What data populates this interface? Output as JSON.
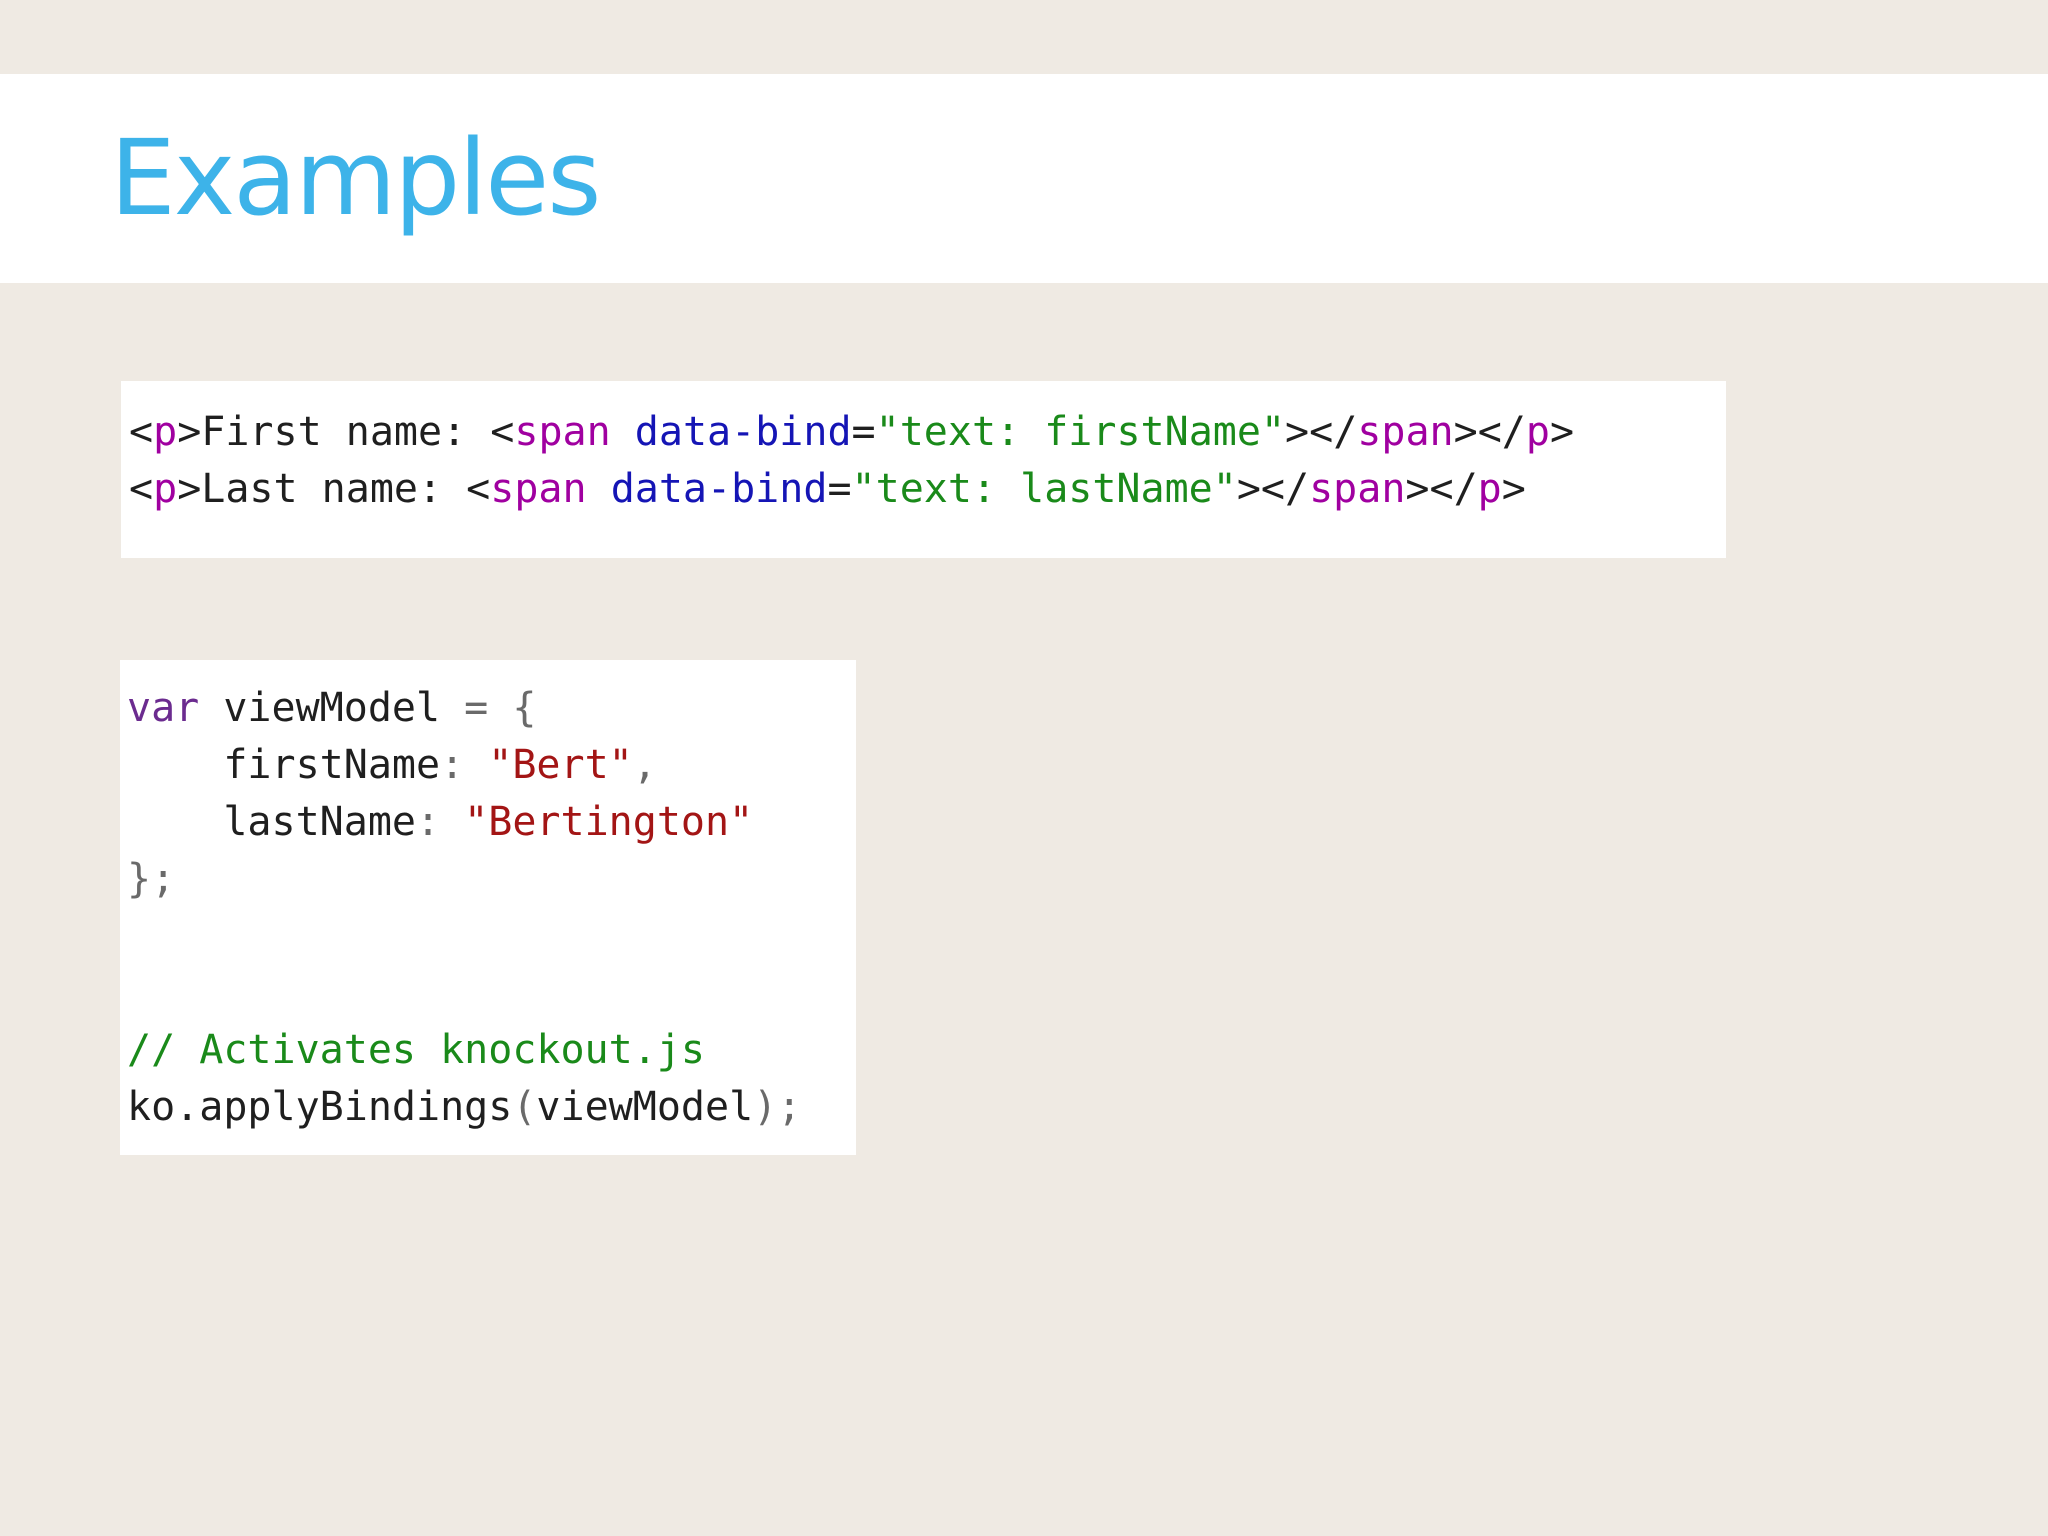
{
  "slide": {
    "title": "Examples"
  },
  "html_snippet": {
    "lines": [
      [
        {
          "t": "<",
          "c": "tk-punct"
        },
        {
          "t": "p",
          "c": "tk-tag"
        },
        {
          "t": ">First name: ",
          "c": "tk-punct"
        },
        {
          "t": "<",
          "c": "tk-punct"
        },
        {
          "t": "span",
          "c": "tk-tag"
        },
        {
          "t": " ",
          "c": "tk-punct"
        },
        {
          "t": "data-bind",
          "c": "tk-attr"
        },
        {
          "t": "=",
          "c": "tk-punct"
        },
        {
          "t": "\"text: firstName\"",
          "c": "tk-str"
        },
        {
          "t": "></",
          "c": "tk-punct"
        },
        {
          "t": "span",
          "c": "tk-tag"
        },
        {
          "t": "></",
          "c": "tk-punct"
        },
        {
          "t": "p",
          "c": "tk-tag"
        },
        {
          "t": ">",
          "c": "tk-punct"
        }
      ],
      [
        {
          "t": "<",
          "c": "tk-punct"
        },
        {
          "t": "p",
          "c": "tk-tag"
        },
        {
          "t": ">Last name: ",
          "c": "tk-punct"
        },
        {
          "t": "<",
          "c": "tk-punct"
        },
        {
          "t": "span",
          "c": "tk-tag"
        },
        {
          "t": " ",
          "c": "tk-punct"
        },
        {
          "t": "data-bind",
          "c": "tk-attr"
        },
        {
          "t": "=",
          "c": "tk-punct"
        },
        {
          "t": "\"text: lastName\"",
          "c": "tk-str"
        },
        {
          "t": "></",
          "c": "tk-punct"
        },
        {
          "t": "span",
          "c": "tk-tag"
        },
        {
          "t": "></",
          "c": "tk-punct"
        },
        {
          "t": "p",
          "c": "tk-tag"
        },
        {
          "t": ">",
          "c": "tk-punct"
        }
      ]
    ]
  },
  "js_snippet": {
    "lines": [
      [
        {
          "t": "var",
          "c": "tk-kw"
        },
        {
          "t": " viewModel ",
          "c": "tk-plain"
        },
        {
          "t": "= {",
          "c": "tk-op"
        }
      ],
      [
        {
          "t": "    firstName",
          "c": "tk-plain"
        },
        {
          "t": ": ",
          "c": "tk-op"
        },
        {
          "t": "\"Bert\"",
          "c": "tk-jsstr"
        },
        {
          "t": ",",
          "c": "tk-op"
        }
      ],
      [
        {
          "t": "    lastName",
          "c": "tk-plain"
        },
        {
          "t": ": ",
          "c": "tk-op"
        },
        {
          "t": "\"Bertington\"",
          "c": "tk-jsstr"
        }
      ],
      [
        {
          "t": "};",
          "c": "tk-op"
        }
      ],
      [],
      [],
      [
        {
          "t": "// Activates knockout.js",
          "c": "tk-comment"
        }
      ],
      [
        {
          "t": "ko.applyBindings",
          "c": "tk-plain"
        },
        {
          "t": "(",
          "c": "tk-op"
        },
        {
          "t": "viewModel",
          "c": "tk-plain"
        },
        {
          "t": ");",
          "c": "tk-op"
        }
      ]
    ]
  },
  "colors": {
    "title": "#3db3e9",
    "page_background": "#efeae3",
    "code_background": "#ffffff"
  }
}
